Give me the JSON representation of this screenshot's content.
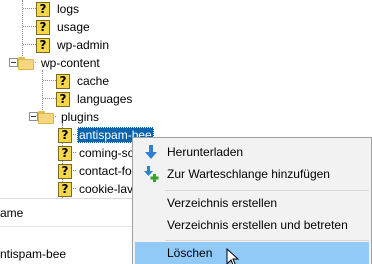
{
  "tree": {
    "items": [
      {
        "label": "logs",
        "icon": "unknown-file-icon"
      },
      {
        "label": "usage",
        "icon": "unknown-file-icon"
      },
      {
        "label": "wp-admin",
        "icon": "unknown-file-icon"
      },
      {
        "label": "wp-content",
        "icon": "folder-open-icon"
      },
      {
        "label": "cache",
        "icon": "unknown-file-icon"
      },
      {
        "label": "languages",
        "icon": "unknown-file-icon"
      },
      {
        "label": "plugins",
        "icon": "folder-open-icon"
      },
      {
        "label": "antispam-bee",
        "icon": "unknown-file-icon",
        "selected": true
      },
      {
        "label": "coming-so",
        "icon": "unknown-file-icon"
      },
      {
        "label": "contact-fo",
        "icon": "unknown-file-icon"
      },
      {
        "label": "cookie-lav",
        "icon": "unknown-file-icon"
      }
    ],
    "unknown_glyph": "?"
  },
  "file_list": {
    "column_header": "ame",
    "rows": [
      "ntispam-bee"
    ]
  },
  "context_menu": {
    "items": [
      {
        "label": "Herunterladen",
        "icon": "download-arrow-icon"
      },
      {
        "label": "Zur Warteschlange hinzufügen",
        "icon": "add-to-queue-icon"
      },
      {
        "label": "Verzeichnis erstellen"
      },
      {
        "label": "Verzeichnis erstellen und betreten"
      },
      {
        "label": "Löschen",
        "hovered": true
      }
    ]
  },
  "colors": {
    "selection": "#0a64ad",
    "menu_hover": "#91c9f7",
    "menu_background": "#f2f2f2",
    "download_arrow": "#2f7fd6",
    "add_plus": "#3aa02f"
  }
}
